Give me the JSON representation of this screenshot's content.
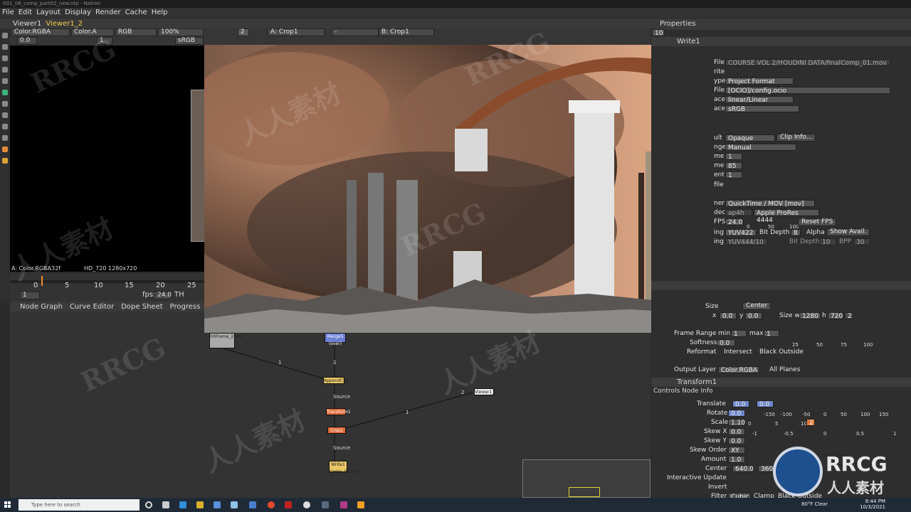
{
  "window": {
    "title": "001_08_comp_part02_new.ntp - Natron"
  },
  "menu": [
    "File",
    "Edit",
    "Layout",
    "Display",
    "Render",
    "Cache",
    "Help"
  ],
  "viewer": {
    "tabs": [
      "Viewer1",
      "Viewer1_2"
    ],
    "layer": "Color.RGBA",
    "alpha": "Color.A",
    "channels": "RGB",
    "zoom": "100%",
    "input_a": "A: Crop1",
    "operation": "-",
    "input_b": "B: Crop1",
    "proxy_level": "2",
    "gain": "0.0",
    "gamma": "1",
    "colorspace": "sRGB",
    "info_left": "A: Color.RGBA32f",
    "info_format": "HD_720 1280x720"
  },
  "timeline": {
    "ticks": [
      "0",
      "5",
      "10",
      "15",
      "20",
      "25"
    ],
    "current_frame": "1",
    "fps_label": "fps:",
    "fps": "24.0",
    "th_label": "TH"
  },
  "graph_tabs": [
    "Node Graph",
    "Curve Editor",
    "Dope Sheet",
    "Progress"
  ],
  "nodes": {
    "read": "00Frame_2,000",
    "merge": "Merge5 (over)",
    "append": "AppendClip",
    "transform": "Transform1",
    "crop": "Crop1",
    "write": "Write1 Comp_01.mov",
    "viewer": "Viewer1_2",
    "edge_labels": [
      "1",
      "2",
      "Source",
      "2",
      "1",
      "Source"
    ]
  },
  "properties": {
    "title": "Properties",
    "max_panels": "10",
    "write_node": "Write1",
    "file_label": "File",
    "file": "COURSE VOL 2/HOUDINI DATA/finalComp_01.mov",
    "rows": [
      {
        "label": "rite",
        "value": ""
      },
      {
        "label": "ype",
        "value": "Project Format"
      },
      {
        "label": "File",
        "value": "[OCIO]/config.ocio"
      },
      {
        "label": "ace",
        "value": "linear/Linear"
      },
      {
        "label": "ace",
        "value": "sRGB"
      }
    ],
    "premult_label": "ult",
    "premult": "Opaque",
    "clip_info": "Clip Info...",
    "range_label": "nge",
    "range": "Manual",
    "first_label": "me",
    "first": "1",
    "last_label": "me",
    "last": "85",
    "incr_label": "ent",
    "incr": "1",
    "file_x": "file",
    "container_label": "ner",
    "container": "QuickTime / MOV [mov]",
    "codec_label": "dec",
    "codec_id": "ap4h",
    "codec_name": "Apple ProRes 4444",
    "fps_label": "FPS",
    "fps_value": "24.0",
    "fps_ticks": [
      "0",
      "50",
      "100"
    ],
    "reset_fps": "Reset FPS",
    "enc_label": "ing",
    "enc": "YUV422",
    "bitdepth_label": "Bit Depth",
    "bitdepth": "8",
    "alpha_label": "Alpha",
    "show_avail": "Show Avail.",
    "enc2": "YUV444/10",
    "bitdepth2": "10",
    "bpp_label": "BPP",
    "bpp": "30",
    "crop": {
      "size_label": "Size",
      "center_btn": "Center",
      "x_label": "x",
      "x": "0.0",
      "y_label": "y",
      "y": "0.0",
      "size_w_label": "Size w",
      "w": "1280",
      "h_label": "h",
      "h": "720",
      "par": "2",
      "frame_range_label": "Frame Range",
      "min_label": "min",
      "min": "1",
      "max_label": "max",
      "max": "1",
      "softness_label": "Softness",
      "softness": "0.0",
      "softness_ticks": [
        "25",
        "50",
        "75",
        "100"
      ],
      "reformat_label": "Reformat",
      "intersect_label": "Intersect",
      "black_outside_label": "Black Outside",
      "output_layer_label": "Output Layer",
      "output_layer": "Color.RGBA",
      "all_planes": "All Planes"
    },
    "transform": {
      "name": "Transform1",
      "tabs": [
        "Controls",
        "Node",
        "Info"
      ],
      "translate_label": "Translate",
      "tx": "0.0",
      "ty": "0.0",
      "translate_ticks": [
        "-150",
        "-100",
        "-50",
        "0",
        "50",
        "100",
        "150"
      ],
      "rotate_label": "Rotate",
      "rotate": "0.0",
      "scale_label": "Scale",
      "scale": "1.10",
      "scale_ticks": [
        "0",
        "5",
        "10"
      ],
      "scale_dim": "2",
      "skewx_label": "Skew X",
      "skewx": "0.0",
      "skewy_label": "Skew Y",
      "skewy": "0.0",
      "skew_ticks": [
        "-1",
        "-0.5",
        "0",
        "0.5",
        "1"
      ],
      "skew_order_label": "Skew Order",
      "skew_order": "XY",
      "amount_label": "Amount",
      "amount": "1.0",
      "center_label": "Center",
      "cx": "640.0",
      "cy": "360",
      "interactive_label": "Interactive Update",
      "invert_label": "Invert",
      "filter_label": "Filter",
      "filter": "Cubic",
      "clamp_label": "Clamp",
      "black_outside_label": "Black Outside"
    }
  },
  "taskbar": {
    "search_placeholder": "Type here to search",
    "weather": "80°F Clear",
    "time": "8:44 PM",
    "date": "10/3/2021"
  },
  "watermarks": [
    "RRCG",
    "人人素材",
    "RRCG",
    "人人素材",
    "RRCG",
    "人人素材",
    "RRCG",
    "人人素材"
  ],
  "logo": {
    "text1": "RRCG",
    "text2": "人人素材"
  },
  "colors": {
    "accent_node_yellow": "#e8c766",
    "accent_node_red": "#e06b3a",
    "highlight_field": "#6e86c9",
    "tab_active": "#f2c94c"
  }
}
